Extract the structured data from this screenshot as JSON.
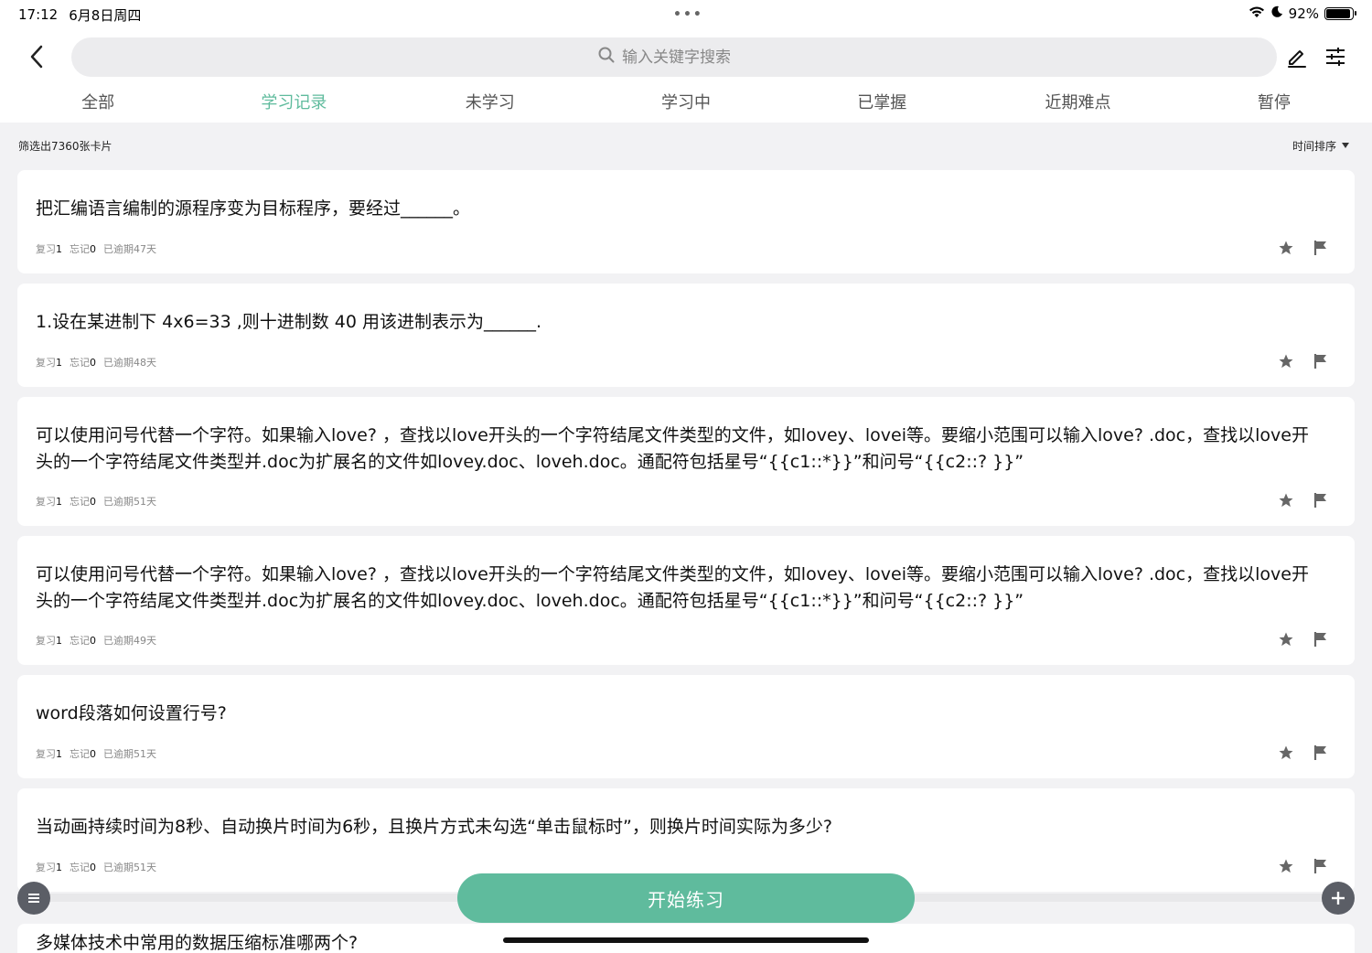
{
  "status_bar": {
    "time": "17:12",
    "date": "6月8日周四",
    "dots": "•••",
    "battery": "92%",
    "battery_level": 0.92
  },
  "header": {
    "search_placeholder": "输入关键字搜索"
  },
  "tabs": [
    {
      "label": "全部",
      "active": false
    },
    {
      "label": "学习记录",
      "active": true
    },
    {
      "label": "未学习",
      "active": false
    },
    {
      "label": "学习中",
      "active": false
    },
    {
      "label": "已掌握",
      "active": false
    },
    {
      "label": "近期难点",
      "active": false
    },
    {
      "label": "暂停",
      "active": false
    }
  ],
  "summary": {
    "count_text": "筛选出7360张卡片",
    "sort_label": "时间排序"
  },
  "cards": [
    {
      "text": "把汇编语言编制的源程序变为目标程序，要经过______。",
      "review_label": "复习",
      "review_count": "1",
      "forget_label": "忘记",
      "forget_count": "0",
      "overdue": "已逾期47天"
    },
    {
      "text": "1.设在某进制下 4x6=33 ,则十进制数 40 用该进制表示为______.",
      "review_label": "复习",
      "review_count": "1",
      "forget_label": "忘记",
      "forget_count": "0",
      "overdue": "已逾期48天"
    },
    {
      "text": "可以使用问号代替一个字符。如果输入love? ，查找以love开头的一个字符结尾文件类型的文件，如lovey、lovei等。要缩小范围可以输入love? .doc，查找以love开头的一个字符结尾文件类型并.doc为扩展名的文件如lovey.doc、loveh.doc。通配符包括星号“{{c1::*}}”和问号“{{c2::? }}”",
      "review_label": "复习",
      "review_count": "1",
      "forget_label": "忘记",
      "forget_count": "0",
      "overdue": "已逾期51天"
    },
    {
      "text": "可以使用问号代替一个字符。如果输入love? ，查找以love开头的一个字符结尾文件类型的文件，如lovey、lovei等。要缩小范围可以输入love? .doc，查找以love开头的一个字符结尾文件类型并.doc为扩展名的文件如lovey.doc、loveh.doc。通配符包括星号“{{c1::*}}”和问号“{{c2::? }}”",
      "review_label": "复习",
      "review_count": "1",
      "forget_label": "忘记",
      "forget_count": "0",
      "overdue": "已逾期49天"
    },
    {
      "text": "word段落如何设置行号?",
      "review_label": "复习",
      "review_count": "1",
      "forget_label": "忘记",
      "forget_count": "0",
      "overdue": "已逾期51天"
    },
    {
      "text": "当动画持续时间为8秒、自动换片时间为6秒，且换片方式未勾选“单击鼠标时”，则换片时间实际为多少?",
      "review_label": "复习",
      "review_count": "1",
      "forget_label": "忘记",
      "forget_count": "0",
      "overdue": "已逾期51天"
    }
  ],
  "peek_card_text": "多媒体技术中常用的数据压缩标准哪两个?",
  "bottom": {
    "start_label": "开始练习"
  },
  "colors": {
    "accent": "#5fbb9d",
    "fab": "#5b5e66",
    "background": "#f2f2f4"
  }
}
